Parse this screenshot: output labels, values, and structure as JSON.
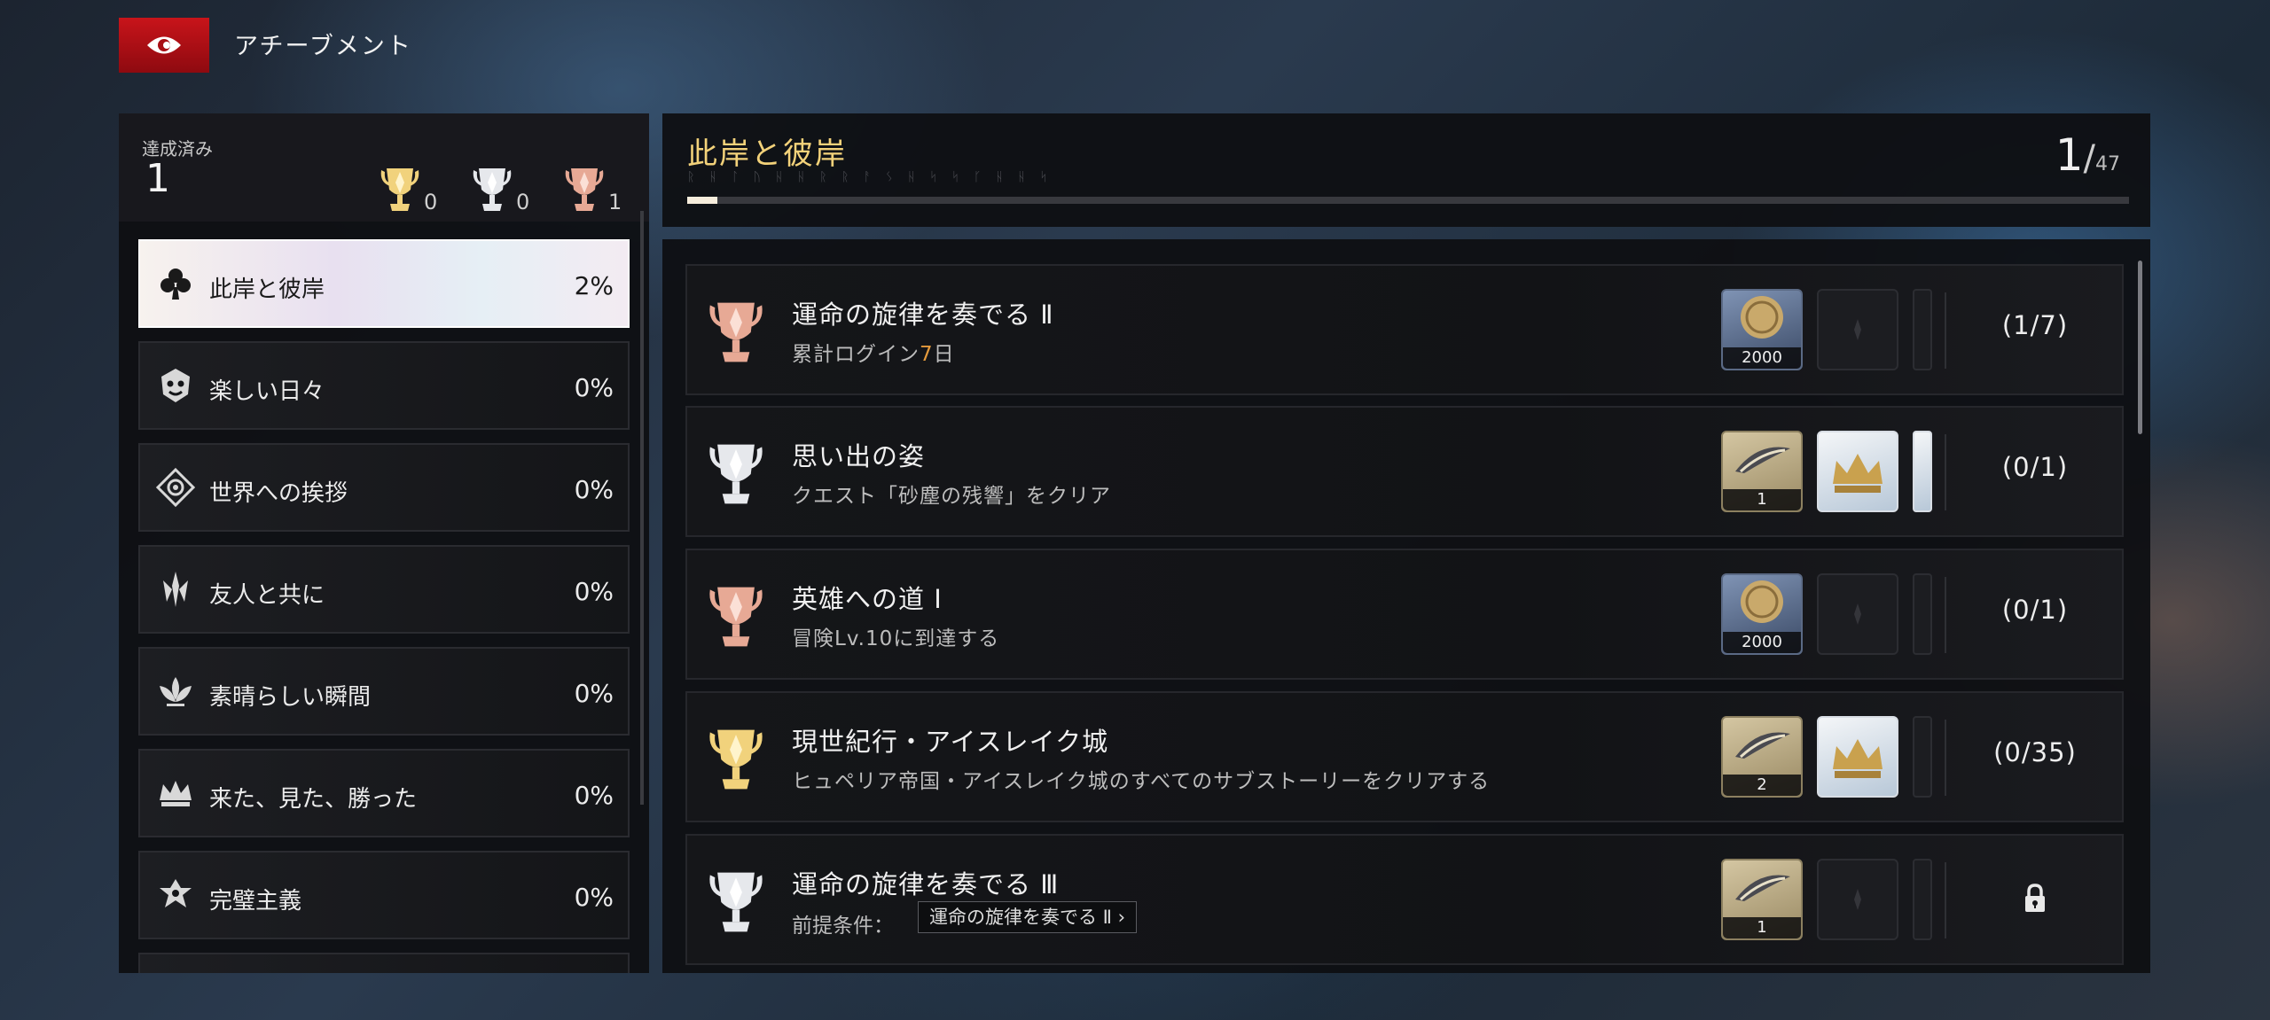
{
  "header": {
    "title": "アチーブメント"
  },
  "summary": {
    "label": "達成済み",
    "count": "1",
    "trophies": [
      {
        "tier": "gold",
        "count": "0"
      },
      {
        "tier": "silver",
        "count": "0"
      },
      {
        "tier": "bronze",
        "count": "1"
      }
    ]
  },
  "categories": [
    {
      "label": "此岸と彼岸",
      "pct": "2%",
      "active": true,
      "icon": "spade-icon"
    },
    {
      "label": "楽しい日々",
      "pct": "0%",
      "icon": "mask-icon"
    },
    {
      "label": "世界への挨拶",
      "pct": "0%",
      "icon": "compass-icon"
    },
    {
      "label": "友人と共に",
      "pct": "0%",
      "icon": "blades-icon"
    },
    {
      "label": "素晴らしい瞬間",
      "pct": "0%",
      "icon": "lotus-icon"
    },
    {
      "label": "来た、見た、勝った",
      "pct": "0%",
      "icon": "crown-icon"
    },
    {
      "label": "完璧主義",
      "pct": "0%",
      "icon": "emblem-icon"
    }
  ],
  "detail": {
    "title": "此岸と彼岸",
    "subtitle": "ᚱ ᚺ ᛚ ᚢ ᚺ ᚺ ᚱ ᚱ   ᚨ ᛊ ᚺ   ᛋ ᛋ ᚴ ᚺ ᚺ ᛋ",
    "progress_current": "1",
    "progress_total": "47",
    "progress_fraction": 0.021
  },
  "achievements": [
    {
      "tier": "bronze",
      "title": "運命の旋律を奏でる Ⅱ",
      "desc_pre": "累計ログイン",
      "desc_hl": "7",
      "desc_post": "日",
      "progress": "(1/7)",
      "rewards": [
        {
          "type": "coin",
          "qty": "2000"
        },
        {
          "type": "empty"
        },
        {
          "type": "empty"
        }
      ]
    },
    {
      "tier": "silver",
      "title": "思い出の姿",
      "desc": "クエスト「砂塵の残響」をクリア",
      "progress": "(0/1)",
      "rewards": [
        {
          "type": "quill",
          "qty": "1"
        },
        {
          "type": "crown"
        },
        {
          "type": "crown"
        }
      ]
    },
    {
      "tier": "bronze",
      "title": "英雄への道 Ⅰ",
      "desc": "冒険Lv.10に到達する",
      "progress": "(0/1)",
      "rewards": [
        {
          "type": "coin",
          "qty": "2000"
        },
        {
          "type": "empty"
        },
        {
          "type": "empty"
        }
      ]
    },
    {
      "tier": "gold",
      "title": "現世紀行・アイスレイク城",
      "desc": "ヒュペリア帝国・アイスレイク城のすべてのサブストーリーをクリアする",
      "progress": "(0/35)",
      "rewards": [
        {
          "type": "quill",
          "qty": "2"
        },
        {
          "type": "crown"
        },
        {
          "type": "empty"
        }
      ]
    },
    {
      "tier": "silver",
      "title": "運命の旋律を奏でる Ⅲ",
      "req_label": "前提条件：",
      "req_tag": "運命の旋律を奏でる Ⅱ ›",
      "progress": "locked",
      "rewards": [
        {
          "type": "quill",
          "qty": "1"
        },
        {
          "type": "empty"
        },
        {
          "type": "empty"
        }
      ]
    }
  ],
  "colors": {
    "gold": "#f1d27c",
    "silver": "#e6e8ec",
    "bronze": "#e7a995",
    "accent_title": "#f3d27a"
  }
}
